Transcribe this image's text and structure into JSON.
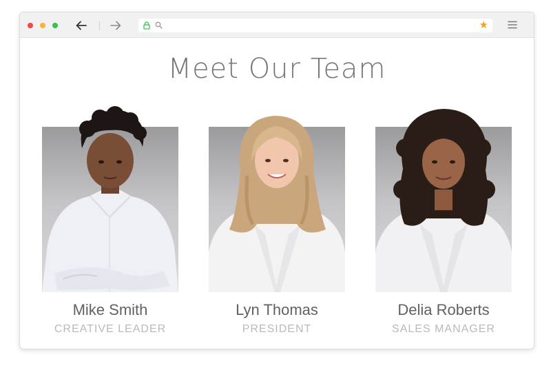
{
  "page": {
    "title": "Meet Our Team"
  },
  "browser": {
    "address_value": "",
    "icons": [
      "back-arrow-icon",
      "forward-arrow-icon",
      "lock-icon",
      "search-icon",
      "star-icon",
      "hamburger-menu-icon"
    ],
    "colors": {
      "close": "#ef4a47",
      "minimize": "#f5b431",
      "maximize": "#3cc14d",
      "lock": "#3cc14d",
      "star": "#f3a21c"
    }
  },
  "team": [
    {
      "name": "Mike Smith",
      "role": "CREATIVE LEADER"
    },
    {
      "name": "Lyn Thomas",
      "role": "PRESIDENT"
    },
    {
      "name": "Delia Roberts",
      "role": "SALES MANAGER"
    }
  ]
}
